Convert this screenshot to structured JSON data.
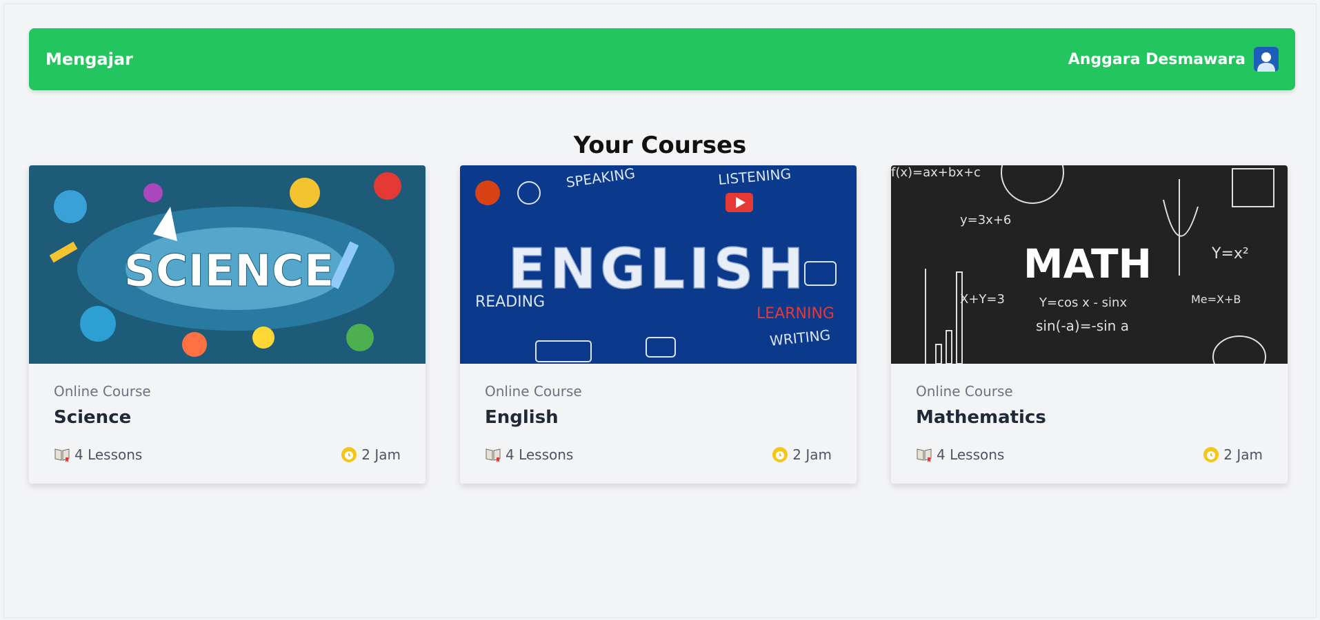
{
  "navbar": {
    "brand": "Mengajar",
    "user_name": "Anggara Desmawara",
    "avatar_icon": "user-avatar-icon",
    "bg_color": "#22c55e"
  },
  "page": {
    "title": "Your Courses"
  },
  "courses": [
    {
      "category": "Online Course",
      "title": "Science",
      "lessons": "4 Lessons",
      "duration": "2 Jam",
      "thumb_text": "SCIENCE",
      "thumb_color": "#1e5b78"
    },
    {
      "category": "Online Course",
      "title": "English",
      "lessons": "4 Lessons",
      "duration": "2 Jam",
      "thumb_text": "ENGLISH",
      "thumb_words": [
        "SPEAKING",
        "LISTENING",
        "READING",
        "LEARNING",
        "WRITING"
      ],
      "thumb_color": "#0b3a8c"
    },
    {
      "category": "Online Course",
      "title": "Mathematics",
      "lessons": "4 Lessons",
      "duration": "2 Jam",
      "thumb_text": "MATH",
      "thumb_formulas": [
        "f(x)=ax+bx+c",
        "y=3x+6",
        "Y=x²",
        "X+Y=3",
        "Y=cos x - sinx",
        "sin(-a)=-sin a",
        "Me=X+B"
      ],
      "thumb_color": "#222222"
    }
  ]
}
